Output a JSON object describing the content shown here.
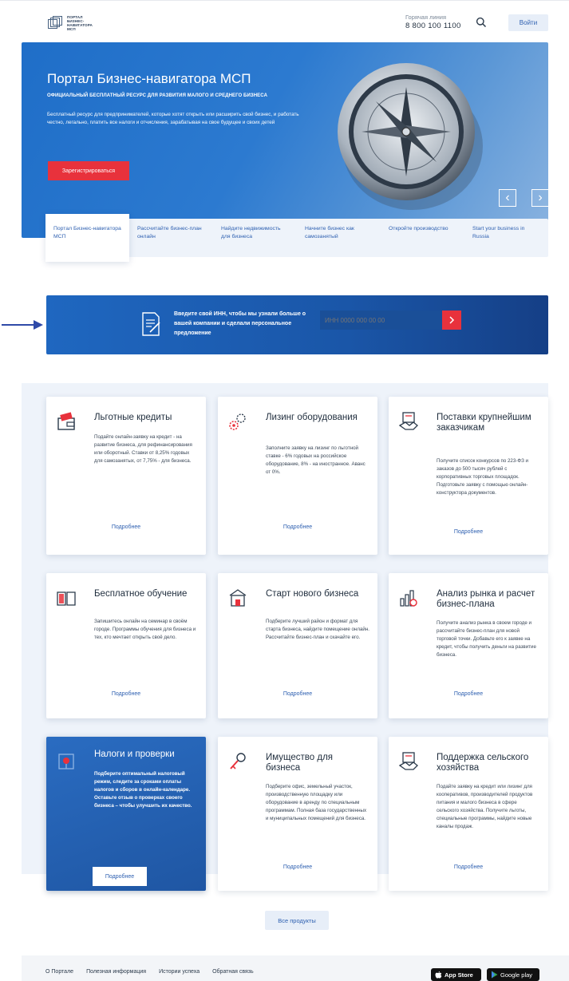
{
  "header": {
    "logo_text": [
      "ПОРТАЛ",
      "БИЗНЕС-",
      "НАВИГАТОРА",
      "МСП"
    ],
    "hotline_label": "Горячая линия",
    "hotline_number": "8 800 100 1100",
    "login_label": "Войти"
  },
  "hero": {
    "title": "Портал Бизнес-навигатора МСП",
    "subtitle": "ОФИЦИАЛЬНЫЙ БЕСПЛАТНЫЙ РЕСУРС ДЛЯ РАЗВИТИЯ МАЛОГО И СРЕДНЕГО БИЗНЕСА",
    "description": "Бесплатный ресурс для предпринимателей, которые хотят открыть или расширить свой бизнес, и работать честно, легально, платить все налоги и отчисления, зарабатывая на свое будущее и своих детей",
    "register_label": "Зарегистрироваться",
    "prev_symbol": "‹",
    "next_symbol": "›"
  },
  "tabs": [
    {
      "label": "Портал Бизнес-навигатора МСП",
      "active": true
    },
    {
      "label": "Рассчитайте бизнес-план онлайн",
      "active": false
    },
    {
      "label": "Найдите недвижимость для бизнеса",
      "active": false
    },
    {
      "label": "Начните бизнес как самозанятый",
      "active": false
    },
    {
      "label": "Откройте производство",
      "active": false
    },
    {
      "label": "Start your business in Russia",
      "active": false
    }
  ],
  "inn": {
    "text": "Введите свой ИНН, чтобы мы узнали больше о вашей компании и сделали персональное предложение",
    "placeholder": "ИНН 0000 000 00 00"
  },
  "cards": [
    {
      "title": "Льготные кредиты",
      "icon": "credit-card-icon",
      "text": "Подайте онлайн-заявку на кредит - на развитие бизнеса, для рефинансирования или оборотный. Ставки от 8,25% годовых для самозанятых, от 7,75% - для бизнеса.",
      "more": "Подробнее"
    },
    {
      "title": "Лизинг оборудования",
      "icon": "gears-icon",
      "text": "Заполните заявку на лизинг по льготной ставке - 6% годовых на российское оборудование, 8% - на иностранное. Аванс от 0%.",
      "more": "Подробнее"
    },
    {
      "title": "Поставки крупнейшим заказчикам",
      "icon": "handshake-icon",
      "text": "Получите список конкурсов по 223-ФЗ и заказов до 500 тысяч рублей с корпоративных торговых площадок. Подготовьте заявку с помощью онлайн-конструктора документов.",
      "more": "Подробнее"
    },
    {
      "title": "Бесплатное обучение",
      "icon": "book-icon",
      "text": "Запишитесь онлайн на семинар в своём городе. Программы обучения для бизнеса и тех, кто мечтает открыть своё дело.",
      "more": "Подробнее"
    },
    {
      "title": "Старт нового бизнеса",
      "icon": "shop-icon",
      "text": "Подберите лучший район и формат для старта бизнеса, найдите помещение онлайн. Рассчитайте бизнес-план и скачайте его.",
      "more": "Подробнее"
    },
    {
      "title": "Анализ рынка и расчет бизнес-плана",
      "icon": "analytics-icon",
      "text": "Получите анализ рынка в своем городе и рассчитайте бизнес-план для новой торговой точки. Добавьте его к заявке на кредит, чтобы получить деньги на развитие бизнеса.",
      "more": "Подробнее"
    },
    {
      "title": "Налоги и проверки",
      "icon": "tax-icon",
      "text": "Подберите оптимальный налоговый режим, следите за сроками оплаты налогов и сборов в онлайн-календаре. Оставьте отзыв о проверках своего бизнеса – чтобы улучшить их качество.",
      "more": "Подробнее"
    },
    {
      "title": "Имущество для бизнеса",
      "icon": "key-icon",
      "text": "Подберите офис, земельный участок, производственную площадку или оборудование в аренду по специальным программам. Полная база государственных и муниципальных помещений для бизнеса.",
      "more": "Подробнее"
    },
    {
      "title": "Поддержка сельского хозяйства",
      "icon": "handshake-icon",
      "text": "Подайте заявку на кредит или лизинг для кооперативов, производителей продуктов питания и малого бизнеса в сфере сельского хозяйства. Получите льготы, специальные программы, найдите новые каналы продаж.",
      "more": "Подробнее"
    }
  ],
  "all_products_label": "Все продукты",
  "footer": {
    "links": [
      "О Портале",
      "Полезная информация",
      "Истории успеха",
      "Обратная связь"
    ],
    "app_store": "App Store",
    "google_play": "Google play"
  },
  "colors": {
    "accent": "#2d5fb0",
    "cta": "#e8323c",
    "hero": "#1f6ec8"
  }
}
